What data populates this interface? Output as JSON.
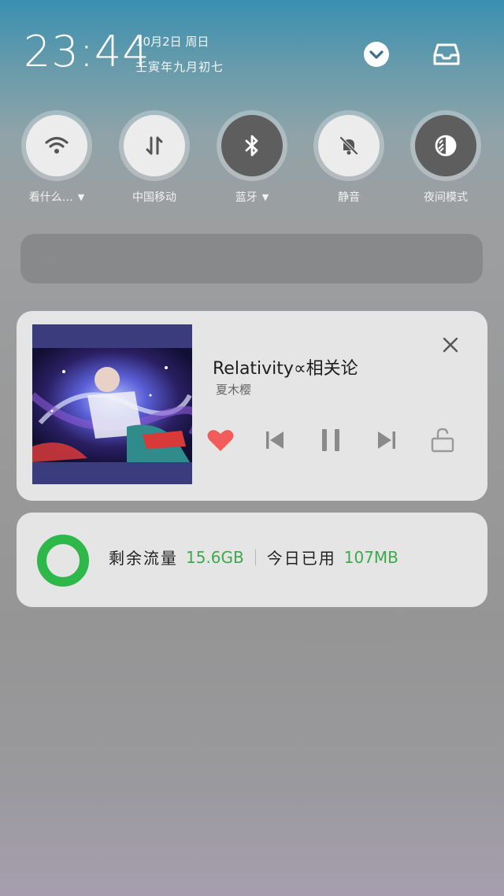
{
  "status": {
    "time": "23:44",
    "date": "10月2日 周日",
    "lunar_date": "壬寅年九月初七"
  },
  "header_buttons": {
    "expand_icon": "chevron-down-icon",
    "inbox_icon": "inbox-tray-icon"
  },
  "quick_toggles": [
    {
      "label": "看什么…",
      "icon": "wifi-icon",
      "state": "off",
      "has_dropdown": true
    },
    {
      "label": "中国移动",
      "icon": "mobile-data-icon",
      "state": "off",
      "has_dropdown": false
    },
    {
      "label": "蓝牙",
      "icon": "bluetooth-icon",
      "state": "on",
      "has_dropdown": true
    },
    {
      "label": "静音",
      "icon": "bell-mute-icon",
      "state": "off",
      "has_dropdown": false
    },
    {
      "label": "夜间模式",
      "icon": "night-mode-icon",
      "state": "on",
      "has_dropdown": false
    }
  ],
  "brightness": {
    "icon": "sun-icon"
  },
  "music_player": {
    "title": "Relativity∝相关论",
    "artist": "夏木樱",
    "liked": true,
    "playing": true,
    "controls": [
      "heart-icon",
      "previous-icon",
      "pause-icon",
      "next-icon",
      "lock-icon"
    ]
  },
  "data_usage": {
    "remaining_label": "剩余流量",
    "remaining_value": "15.6GB",
    "used_today_label": "今日已用",
    "used_today_value": "107MB",
    "accent_color": "#2fb84a"
  },
  "colors": {
    "toggle_off": "#ececec",
    "toggle_on": "#5e5e5e",
    "heart": "#f15c5c",
    "data_accent": "#3caa4a"
  }
}
